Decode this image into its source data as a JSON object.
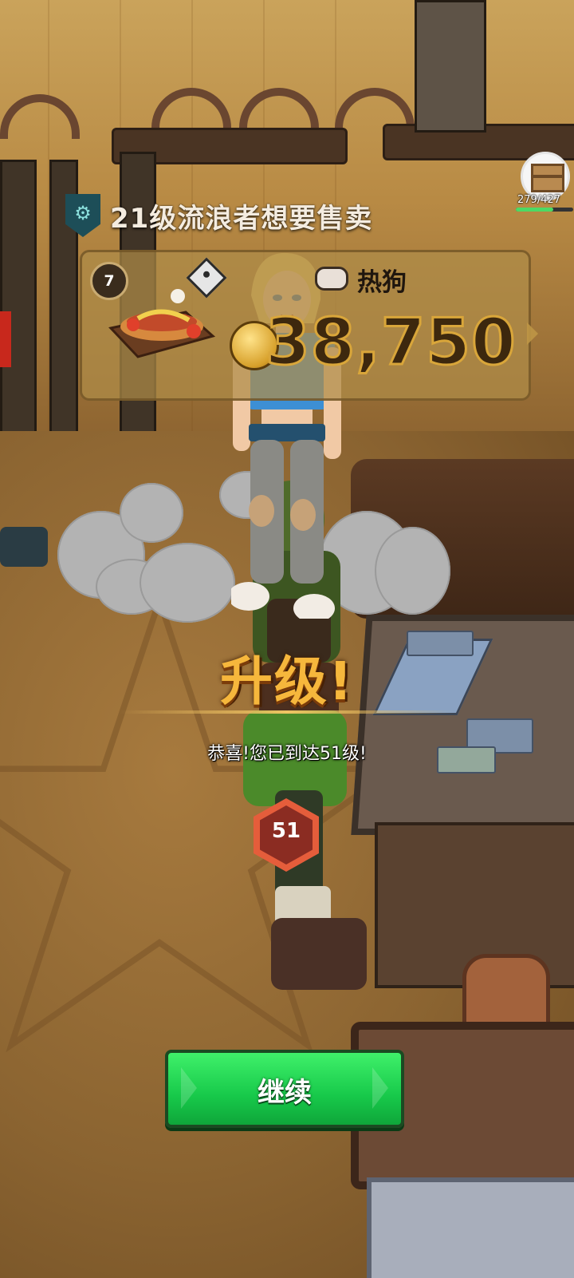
{
  "hud": {
    "chest": {
      "icon": "crate-icon",
      "count_text": "279/427",
      "progress_fraction": 0.65
    }
  },
  "customer": {
    "class_icon": "brass-knuckles-icon",
    "title": "21级流浪者想要售卖",
    "offer": {
      "quantity": "7",
      "quality_icon": "quality-diamond-icon",
      "item_icon": "hotdog-icon",
      "item_name": "热狗",
      "coin_icon": "gold-coin-icon",
      "price": "38,750"
    }
  },
  "level_up": {
    "title": "升级!",
    "message": "恭喜!您已到达51级!",
    "level": "51"
  },
  "buttons": {
    "continue_label": "继续"
  },
  "colors": {
    "title_gold": "#f6b73c",
    "continue_green": "#17c94a",
    "badge_red": "#e55d3b"
  }
}
